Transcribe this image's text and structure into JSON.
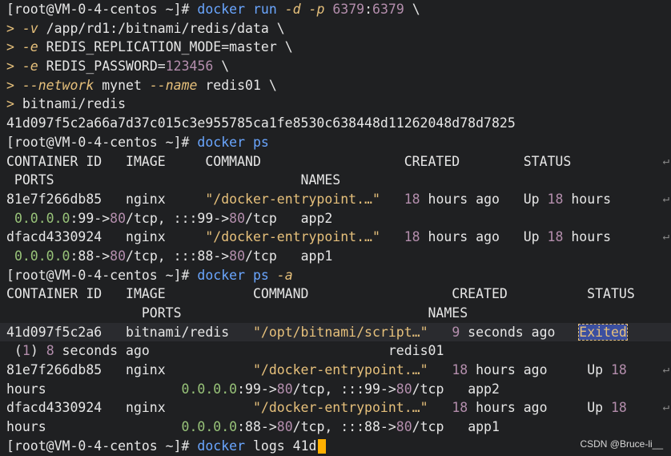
{
  "prompt": "[root@VM-0-4-centos ~]#",
  "lines": [
    [
      {
        "t": "[root@VM-0-4-centos ~]# ",
        "c": "c-prompt"
      },
      {
        "t": "docker run ",
        "c": "c-cmd"
      },
      {
        "t": "-d",
        "c": "c-opt"
      },
      {
        "t": " ",
        "c": "c-txt"
      },
      {
        "t": "-p",
        "c": "c-opt"
      },
      {
        "t": " ",
        "c": "c-txt"
      },
      {
        "t": "6379",
        "c": "c-num"
      },
      {
        "t": ":",
        "c": "c-txt"
      },
      {
        "t": "6379",
        "c": "c-num"
      },
      {
        "t": " \\",
        "c": "c-txt"
      }
    ],
    [
      {
        "t": "> ",
        "c": "c-gt"
      },
      {
        "t": "-v",
        "c": "c-opt"
      },
      {
        "t": " /app/rd1",
        "c": "c-txt"
      },
      {
        "t": ":",
        "c": "c-txt"
      },
      {
        "t": "/bitnami/redis/data \\",
        "c": "c-txt"
      }
    ],
    [
      {
        "t": "> ",
        "c": "c-gt"
      },
      {
        "t": "-e",
        "c": "c-opt"
      },
      {
        "t": " REDIS_REPLICATION_MODE=master \\",
        "c": "c-txt"
      }
    ],
    [
      {
        "t": "> ",
        "c": "c-gt"
      },
      {
        "t": "-e",
        "c": "c-opt"
      },
      {
        "t": " REDIS_PASSWORD=",
        "c": "c-txt"
      },
      {
        "t": "123456",
        "c": "c-num"
      },
      {
        "t": " \\",
        "c": "c-txt"
      }
    ],
    [
      {
        "t": "> ",
        "c": "c-gt"
      },
      {
        "t": "--network",
        "c": "c-opt"
      },
      {
        "t": " mynet ",
        "c": "c-txt"
      },
      {
        "t": "--name",
        "c": "c-opt"
      },
      {
        "t": " redis01 \\",
        "c": "c-txt"
      }
    ],
    [
      {
        "t": "> ",
        "c": "c-gt"
      },
      {
        "t": "bitnami/redis",
        "c": "c-txt"
      }
    ],
    [
      {
        "t": "41d097f5c2a66a7d37c015c3e955785ca1fe8530c638448d11262048d78d7825",
        "c": "c-txt"
      }
    ],
    [
      {
        "t": "[root@VM-0-4-centos ~]# ",
        "c": "c-prompt"
      },
      {
        "t": "docker ps",
        "c": "c-cmd"
      }
    ],
    [
      {
        "t": "CONTAINER ID   IMAGE     COMMAND                  CREATED        STATUS",
        "c": "c-txt"
      }
    ],
    [
      {
        "t": " PORTS                               NAMES",
        "c": "c-txt"
      }
    ],
    [
      {
        "t": "81e7f266db85   nginx     ",
        "c": "c-txt"
      },
      {
        "t": "\"/docker-entrypoint.…\"",
        "c": "c-str"
      },
      {
        "t": "   ",
        "c": "c-txt"
      },
      {
        "t": "18",
        "c": "c-num"
      },
      {
        "t": " hours ago   Up ",
        "c": "c-txt"
      },
      {
        "t": "18",
        "c": "c-num"
      },
      {
        "t": " hours",
        "c": "c-txt"
      }
    ],
    [
      {
        "t": " ",
        "c": "c-txt"
      },
      {
        "t": "0.0.0.0",
        "c": "c-ip"
      },
      {
        "t": ":99->",
        "c": "c-txt"
      },
      {
        "t": "80",
        "c": "c-num"
      },
      {
        "t": "/tcp, :::99->",
        "c": "c-txt"
      },
      {
        "t": "80",
        "c": "c-num"
      },
      {
        "t": "/tcp   app2",
        "c": "c-txt"
      }
    ],
    [
      {
        "t": "dfacd4330924   nginx     ",
        "c": "c-txt"
      },
      {
        "t": "\"/docker-entrypoint.…\"",
        "c": "c-str"
      },
      {
        "t": "   ",
        "c": "c-txt"
      },
      {
        "t": "18",
        "c": "c-num"
      },
      {
        "t": " hours ago   Up ",
        "c": "c-txt"
      },
      {
        "t": "18",
        "c": "c-num"
      },
      {
        "t": " hours",
        "c": "c-txt"
      }
    ],
    [
      {
        "t": " ",
        "c": "c-txt"
      },
      {
        "t": "0.0.0.0",
        "c": "c-ip"
      },
      {
        "t": ":88->",
        "c": "c-txt"
      },
      {
        "t": "80",
        "c": "c-num"
      },
      {
        "t": "/tcp, :::88->",
        "c": "c-txt"
      },
      {
        "t": "80",
        "c": "c-num"
      },
      {
        "t": "/tcp   app1",
        "c": "c-txt"
      }
    ],
    [
      {
        "t": "[root@VM-0-4-centos ~]# ",
        "c": "c-prompt"
      },
      {
        "t": "docker ps ",
        "c": "c-cmd"
      },
      {
        "t": "-a",
        "c": "c-opt"
      }
    ],
    [
      {
        "t": "CONTAINER ID   IMAGE           COMMAND                  CREATED          STATUS",
        "c": "c-txt"
      }
    ],
    [
      {
        "t": "                 PORTS                               NAMES",
        "c": "c-txt"
      }
    ],
    [
      {
        "t": "41d097f5c2a6   bitnami/redis   ",
        "c": "c-txt"
      },
      {
        "t": "\"/opt/bitnami/script…\"",
        "c": "c-str"
      },
      {
        "t": "   ",
        "c": "c-txt"
      },
      {
        "t": "9",
        "c": "c-num"
      },
      {
        "t": " seconds ago   ",
        "c": "c-txt"
      },
      {
        "t": "Exited",
        "c": "exited"
      }
    ],
    [
      {
        "t": " (",
        "c": "c-txt"
      },
      {
        "t": "1",
        "c": "c-num"
      },
      {
        "t": ") ",
        "c": "c-txt"
      },
      {
        "t": "8",
        "c": "c-num"
      },
      {
        "t": " seconds ago                              redis01",
        "c": "c-txt"
      }
    ],
    [
      {
        "t": "81e7f266db85   nginx           ",
        "c": "c-txt"
      },
      {
        "t": "\"/docker-entrypoint.…\"",
        "c": "c-str"
      },
      {
        "t": "   ",
        "c": "c-txt"
      },
      {
        "t": "18",
        "c": "c-num"
      },
      {
        "t": " hours ago     Up ",
        "c": "c-txt"
      },
      {
        "t": "18",
        "c": "c-num"
      }
    ],
    [
      {
        "t": "hours                 ",
        "c": "c-txt"
      },
      {
        "t": "0.0.0.0",
        "c": "c-ip"
      },
      {
        "t": ":99->",
        "c": "c-txt"
      },
      {
        "t": "80",
        "c": "c-num"
      },
      {
        "t": "/tcp, :::99->",
        "c": "c-txt"
      },
      {
        "t": "80",
        "c": "c-num"
      },
      {
        "t": "/tcp   app2",
        "c": "c-txt"
      }
    ],
    [
      {
        "t": "dfacd4330924   nginx           ",
        "c": "c-txt"
      },
      {
        "t": "\"/docker-entrypoint.…\"",
        "c": "c-str"
      },
      {
        "t": "   ",
        "c": "c-txt"
      },
      {
        "t": "18",
        "c": "c-num"
      },
      {
        "t": " hours ago     Up ",
        "c": "c-txt"
      },
      {
        "t": "18",
        "c": "c-num"
      }
    ],
    [
      {
        "t": "hours                 ",
        "c": "c-txt"
      },
      {
        "t": "0.0.0.0",
        "c": "c-ip"
      },
      {
        "t": ":88->",
        "c": "c-txt"
      },
      {
        "t": "80",
        "c": "c-num"
      },
      {
        "t": "/tcp, :::88->",
        "c": "c-txt"
      },
      {
        "t": "80",
        "c": "c-num"
      },
      {
        "t": "/tcp   app1",
        "c": "c-txt"
      }
    ],
    [
      {
        "t": "[root@VM-0-4-centos ~]# ",
        "c": "c-prompt"
      },
      {
        "t": "docker ",
        "c": "c-cmd"
      },
      {
        "t": "logs 41d",
        "c": "c-txt"
      }
    ]
  ],
  "watermark": "CSDN @Bruce-li__"
}
